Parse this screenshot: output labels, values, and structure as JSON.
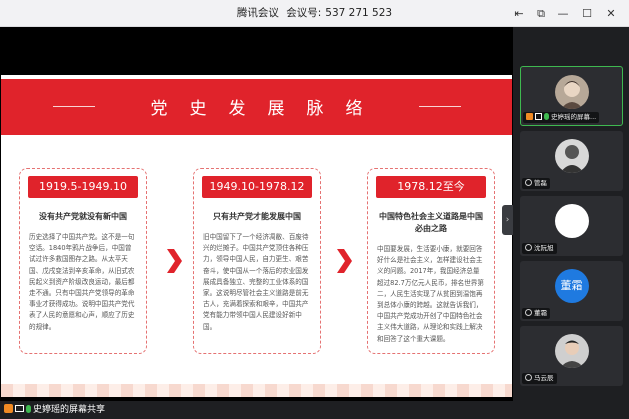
{
  "window": {
    "app_name": "腾讯会议",
    "meeting_id_label": "会议号:",
    "meeting_id": "537 271 523",
    "controls": [
      "⇤",
      "⧉",
      "—",
      "☐",
      "✕"
    ]
  },
  "slide": {
    "title": "党史发展脉络",
    "cards": [
      {
        "period": "1919.5-1949.10",
        "heading": "没有共产党就没有新中国",
        "body": "历史选择了中国共产党。这不是一句空话。1840年鸦片战争后，中国曾试过许多救国图存之路。从太平天国、戊戌变法到辛亥革命，从旧式农民起义到资产阶级改良运动，最后都走不通。只有中国共产党领导的革命事业才获得成功。说明中国共产党代表了人民的意愿和心声，顺应了历史的规律。"
      },
      {
        "period": "1949.10-1978.12",
        "heading": "只有共产党才能发展中国",
        "body": "旧中国留下了一个经济凋敝、百废待兴的烂摊子。中国共产党顶住各种压力，领导中国人民，自力更生、艰苦奋斗，使中国从一个落后的农业国发展成具备独立、完整的工业体系的国家。这说明尽管社会主义道路是前无古人，充满着探索和艰辛，中国共产党有能力带领中国人民建设好新中国。"
      },
      {
        "period": "1978.12至今",
        "heading": "中国特色社会主义道路是中国必由之路",
        "body": "中国要发展，生活要小康，就要回答好什么是社会主义，怎样建设社会主义的问题。2017年，我国经济总量超过82.7万亿元人民币，排名世界第二，人民生活实现了从贫困到温饱再到总体小康的跨越。这就告诉我们，中国共产党成功开创了中国特色社会主义伟大道路，从理论和实践上解决和回答了这个重大课题。"
      }
    ]
  },
  "participants": [
    {
      "name": "史婷瑶的屏幕...",
      "active": true,
      "icon": "photo-avatar"
    },
    {
      "name": "管磊",
      "active": false,
      "icon": "photo-avatar"
    },
    {
      "name": "沈阮旭",
      "active": false,
      "icon": "white-circle-avatar"
    },
    {
      "name": "董霜",
      "active": false,
      "icon": "text-avatar",
      "avatar_text": "董霜"
    },
    {
      "name": "马云辰",
      "active": false,
      "icon": "photo-avatar"
    }
  ],
  "bottom_bar": {
    "share_label": "史婷瑶的屏幕共享"
  },
  "colors": {
    "accent_red": "#e0232b",
    "active_green": "#3fb950",
    "panel_bg": "#1e1f22",
    "text_avatar_blue": "#1f7ae0"
  }
}
